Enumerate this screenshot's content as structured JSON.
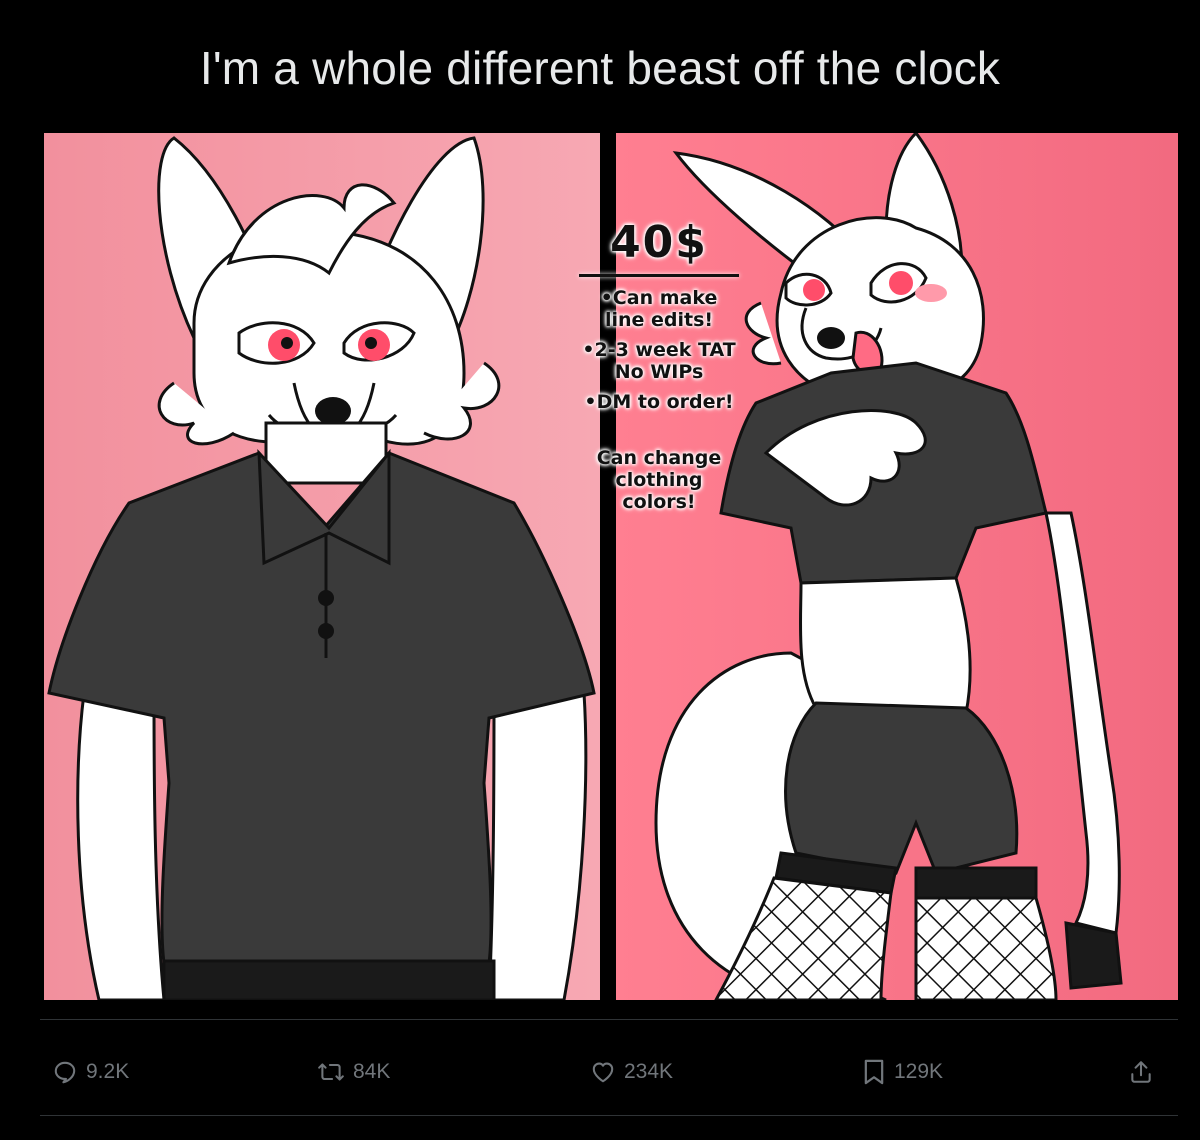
{
  "post": {
    "caption": "I'm a whole different beast off the clock"
  },
  "artwork": {
    "price": "40$",
    "bullets": [
      [
        "•Can make",
        "line edits!"
      ],
      [
        "•2-3 week TAT",
        "No WIPs"
      ],
      [
        "•DM to order!"
      ]
    ],
    "note": [
      "Can change",
      "clothing",
      "colors!"
    ],
    "colors": {
      "left_bg": "#f7a1ad",
      "right_bg": "#fa7389",
      "shirt": "#3a3a3a",
      "eyes": "#ff4d6a"
    }
  },
  "actions": {
    "replies": {
      "icon": "reply-icon",
      "count": "9.2K"
    },
    "reposts": {
      "icon": "repost-icon",
      "count": "84K"
    },
    "likes": {
      "icon": "heart-icon",
      "count": "234K"
    },
    "bookmarks": {
      "icon": "bookmark-icon",
      "count": "129K"
    },
    "share": {
      "icon": "share-icon"
    }
  },
  "colors": {
    "background": "#000000",
    "text": "#e7e9ea",
    "muted": "#71767b",
    "divider": "#2f3336"
  }
}
